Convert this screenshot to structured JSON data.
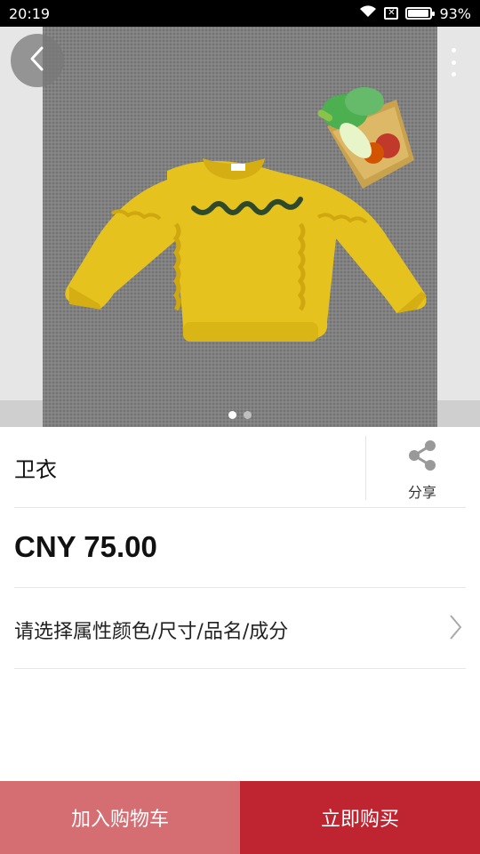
{
  "status_bar": {
    "time": "20:19",
    "battery_text": "93%",
    "battery_level": 0.93,
    "icons": [
      "wifi-icon",
      "notification-x-icon",
      "battery-icon"
    ]
  },
  "carousel": {
    "image_description_icon": "product-photo",
    "pages": 2,
    "active_index": 0
  },
  "product": {
    "title": "卫衣",
    "price": "CNY 75.00",
    "options_label": "请选择属性颜色/尺寸/品名/成分"
  },
  "share": {
    "label": "分享",
    "icon": "share-icon"
  },
  "actions": {
    "add_to_cart": "加入购物车",
    "buy_now": "立即购买"
  },
  "colors": {
    "cart_button": "#d46e73",
    "buy_button": "#bf2431",
    "sweater": "#e6c21e"
  }
}
